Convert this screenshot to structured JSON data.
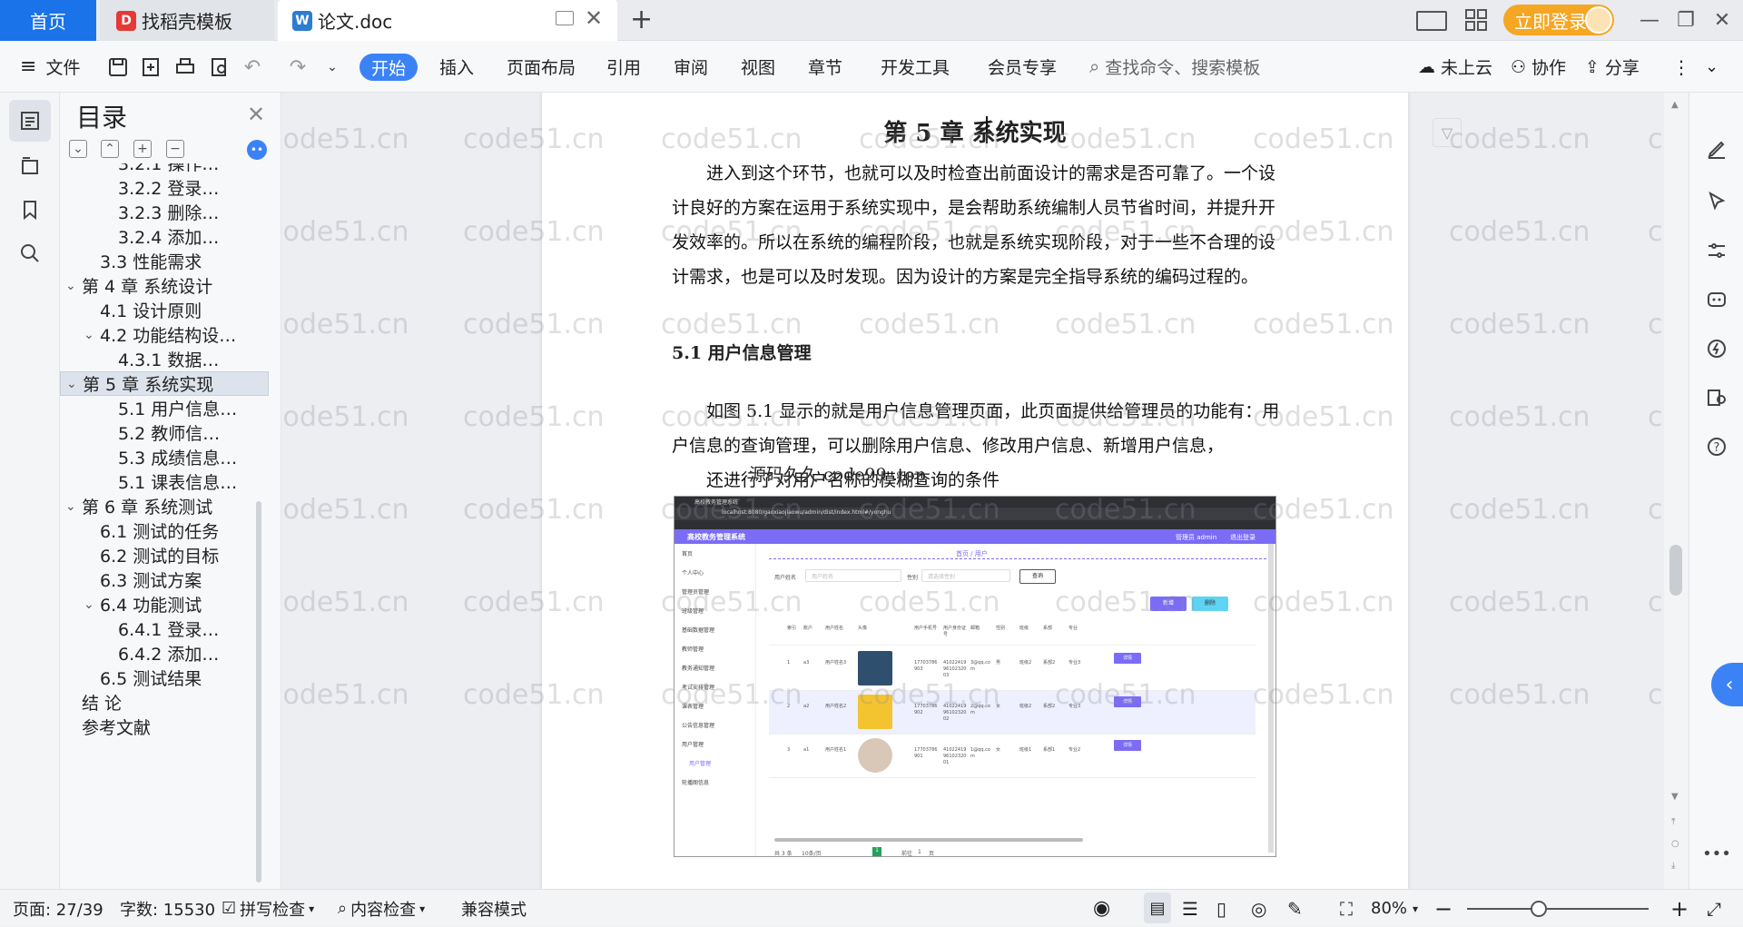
{
  "tabs": {
    "home": "首页",
    "template": "找稻壳模板",
    "document": "论文.doc",
    "new_tab": "+"
  },
  "window": {
    "login": "立即登录"
  },
  "menu": {
    "file": "文件",
    "start": "开始",
    "items": [
      "插入",
      "页面布局",
      "引用",
      "审阅",
      "视图",
      "章节",
      "开发工具",
      "会员专享"
    ],
    "search_placeholder": "查找命令、搜索模板",
    "cloud": "未上云",
    "collab": "协作",
    "share": "分享"
  },
  "toc": {
    "title": "目录",
    "items": [
      {
        "label": "3.2.1  操作…",
        "level": 3,
        "caret": ""
      },
      {
        "label": "3.2.2  登录…",
        "level": 3,
        "caret": ""
      },
      {
        "label": "3.2.3  删除…",
        "level": 3,
        "caret": ""
      },
      {
        "label": "3.2.4  添加…",
        "level": 3,
        "caret": ""
      },
      {
        "label": "3.3  性能需求",
        "level": 2,
        "caret": ""
      },
      {
        "label": "第 4 章  系统设计",
        "level": 1,
        "caret": "v"
      },
      {
        "label": "4.1  设计原则",
        "level": 2,
        "caret": ""
      },
      {
        "label": "4.2  功能结构设…",
        "level": 2,
        "caret": "v"
      },
      {
        "label": "4.3.1  数据…",
        "level": 3,
        "caret": ""
      },
      {
        "label": "第 5 章  系统实现",
        "level": 1,
        "caret": "v",
        "active": true
      },
      {
        "label": "5.1 用户信息…",
        "level": 3,
        "caret": ""
      },
      {
        "label": "5.2  教师信…",
        "level": 3,
        "caret": ""
      },
      {
        "label": "5.3 成绩信息…",
        "level": 3,
        "caret": ""
      },
      {
        "label": "5.1 课表信息…",
        "level": 3,
        "caret": ""
      },
      {
        "label": "第 6 章  系统测试",
        "level": 1,
        "caret": "v"
      },
      {
        "label": "6.1  测试的任务",
        "level": 2,
        "caret": ""
      },
      {
        "label": "6.2  测试的目标",
        "level": 2,
        "caret": ""
      },
      {
        "label": "6.3  测试方案",
        "level": 2,
        "caret": ""
      },
      {
        "label": "6.4  功能测试",
        "level": 2,
        "caret": "v"
      },
      {
        "label": "6.4.1  登录…",
        "level": 3,
        "caret": ""
      },
      {
        "label": "6.4.2  添加…",
        "level": 3,
        "caret": ""
      },
      {
        "label": "6.5  测试结果",
        "level": 2,
        "caret": ""
      },
      {
        "label": "结   论",
        "level": 1,
        "caret": ""
      },
      {
        "label": "参考文献",
        "level": 1,
        "caret": ""
      }
    ]
  },
  "document": {
    "chapter_title": "第 5 章  系统实现",
    "para1": [
      "进入到这个环节，也就可以及时检查出前面设计的需求是否可靠了。一个设",
      "计良好的方案在运用于系统实现中，是会帮助系统编制人员节省时间，并提升开",
      "发效率的。所以在系统的编程阶段，也就是系统实现阶段，对于一些不合理的设",
      "计需求，也是可以及时发现。因为设计的方案是完全指导系统的编码过程的。"
    ],
    "section_title": "5.1 用户信息管理",
    "para2": [
      "如图 5.1 显示的就是用户信息管理页面，此页面提供给管理员的功能有：用",
      "户信息的查询管理，可以删除用户信息、修改用户信息、新增用户信息，",
      "还进行了对用户名称的模糊查询的条件"
    ],
    "overlay_text": "源码久久 code99 .top",
    "watermark": "code51.cn"
  },
  "screenshot": {
    "browser_tab": "高校教务管理系统",
    "url": "localhost:8080/gaoxiaojiaowu/admin/dist/index.html#/yonghu",
    "app_title": "高校教务管理系统",
    "admin_text": "管理员 admin",
    "logout": "退出登录",
    "breadcrumb": "首页 / 用户",
    "menu": [
      "首页",
      "个人中心",
      "管理员管理",
      "班级管理",
      "基础数据管理",
      "教师管理",
      "教务通知管理",
      "考试安排管理",
      "课表管理",
      "公告信息管理",
      "用户管理",
      "用户管理",
      "轮播图信息"
    ],
    "filter_name_label": "用户姓名",
    "filter_name_ph": "用户姓名",
    "filter_gender_label": "性别",
    "filter_gender_ph": "请选择性别",
    "query_btn": "查询",
    "add_btn": "新增",
    "delete_btn": "删除",
    "columns": [
      "索引",
      "账户",
      "用户姓名",
      "头像",
      "用户手机号",
      "用户身份证号",
      "邮箱",
      "性别",
      "班级",
      "系部",
      "专业"
    ],
    "rows": [
      [
        "1",
        "a3",
        "用户姓名3",
        "",
        "17703786903",
        "410224199610232003",
        "3@qq.com",
        "男",
        "班级2",
        "系部2",
        "专业3"
      ],
      [
        "2",
        "a2",
        "用户姓名2",
        "",
        "17703786902",
        "410224199610232002",
        "2@qq.com",
        "女",
        "班级2",
        "系部2",
        "专业3"
      ],
      [
        "3",
        "a1",
        "用户姓名1",
        "",
        "17703786901",
        "410224199610232001",
        "1@qq.com",
        "女",
        "班级1",
        "系部1",
        "专业2"
      ]
    ],
    "detail_btn": "详情",
    "pager_total": "共 3 条",
    "pager_size": "10条/页",
    "pager_page": "1",
    "pager_goto": "前往",
    "pager_goto_page": "1",
    "pager_unit": "页"
  },
  "status": {
    "page": "页面: 27/39",
    "words": "字数: 15530",
    "spell": "拼写检查",
    "content_check": "内容检查",
    "compat": "兼容模式",
    "zoom": "80%"
  },
  "colors": {
    "accent": "#3b82f6",
    "login": "#f5a623",
    "app_header": "#7b6cf6"
  }
}
